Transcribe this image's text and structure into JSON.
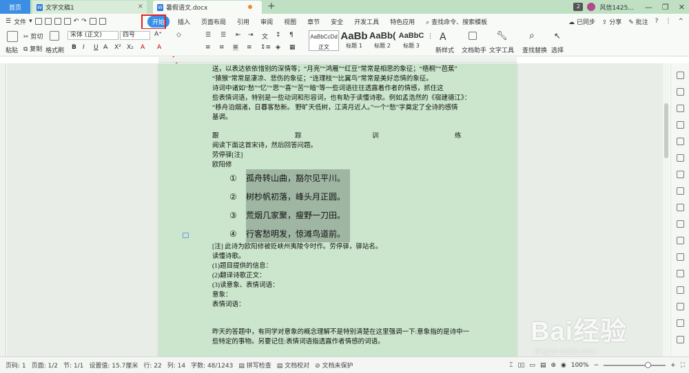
{
  "tabbar": {
    "home": "首页",
    "tabs": [
      {
        "label": "文字文稿1"
      },
      {
        "label": "暑假语文.docx"
      }
    ],
    "add": "+",
    "badge": "2",
    "user": "风信1425..."
  },
  "menubar": {
    "file": "文件",
    "start": "开始",
    "items": [
      "插入",
      "页面布局",
      "引用",
      "审阅",
      "视图",
      "章节",
      "安全",
      "开发工具",
      "特色应用"
    ],
    "search": "查找命令、搜索模板",
    "sync": "已同步",
    "share": "分享",
    "annot": "批注"
  },
  "ribbon": {
    "paste": "粘贴",
    "cut": "剪切",
    "copy": "复制",
    "format_painter": "格式刷",
    "font": "宋体 (正文)",
    "size": "四号",
    "styles": [
      {
        "sample": "AaBbCcDd",
        "cap": "正文"
      },
      {
        "sample": "AaBb",
        "cap": "标题 1"
      },
      {
        "sample": "AaBb(",
        "cap": "标题 2"
      },
      {
        "sample": "AaBbC",
        "cap": "标题 3"
      }
    ],
    "new_style": "新样式",
    "doc_helper": "文档助手",
    "text_tools": "文字工具",
    "find_replace": "查找替换",
    "select": "选择"
  },
  "document": {
    "lines": [
      "送，以表达依依惜别的深情等；“月亮”“鸿雁”“红豆”常常是相思的象征；“梧桐”“芭蕉”",
      "“猿猴”常常是凄凉、悲伤的象征；“连理枝”“比翼鸟”常常是美好恋情的象征。",
      "诗词中诸如“愁”“忆”“思”“喜”“苦”“暗”等一些词语往往透露着作者的情感，抓住这",
      "些表情词语，特别是一些动词和形容词，也有助于读懂诗歌。例如孟浩然的《宿建德江》：",
      "“移舟泊烟渚，日暮客愁新。 野旷天低树，江清月近人。”一个“愁”字奠定了全诗的感情",
      "基调。"
    ],
    "heading_chars": [
      "跟",
      "踪",
      "训",
      "练"
    ],
    "intro": [
      "阅读下面这首宋诗，然后回答问题。",
      "劳停驿[注]",
      "欧阳修"
    ],
    "poem": [
      {
        "num": "①",
        "text": "孤舟转山曲，豁尔见平川。"
      },
      {
        "num": "②",
        "text": "树杪帆初落，峰头月正圆。"
      },
      {
        "num": "③",
        "text": "荒烟几家聚，瘦野一刀田。"
      },
      {
        "num": "④",
        "text": "行客愁明发，惊滩鸟道前。"
      }
    ],
    "after": [
      "[注] 此诗为欧阳修被贬峡州夷陵令时作。劳停驿，驿站名。",
      "读懂诗歌。",
      "(1)题目提供的信息：",
      "(2)翻译诗歌正文：",
      "(3)读意象、表情词语：",
      "意象：",
      "表情词语："
    ],
    "closing": [
      "昨天的答题中，有同学对意象的概念理解不是特别清楚在这里强调一下:意象指的是诗中一",
      "些特定的事物。另要记住:表情词语指透露作者情感的词语。"
    ]
  },
  "statusbar": {
    "page_num": "页码: 1",
    "page": "页面: 1/2",
    "section": "节: 1/1",
    "setting": "设置值: 15.7厘米",
    "row": "行: 22",
    "col": "列: 14",
    "words": "字数: 48/1243",
    "spell": "拼写检查",
    "proof": "文档校对",
    "protect": "文档未保护",
    "zoom": "100%"
  },
  "watermark": {
    "brand": "Bai经验",
    "url": "jingyan.baidu.com"
  }
}
